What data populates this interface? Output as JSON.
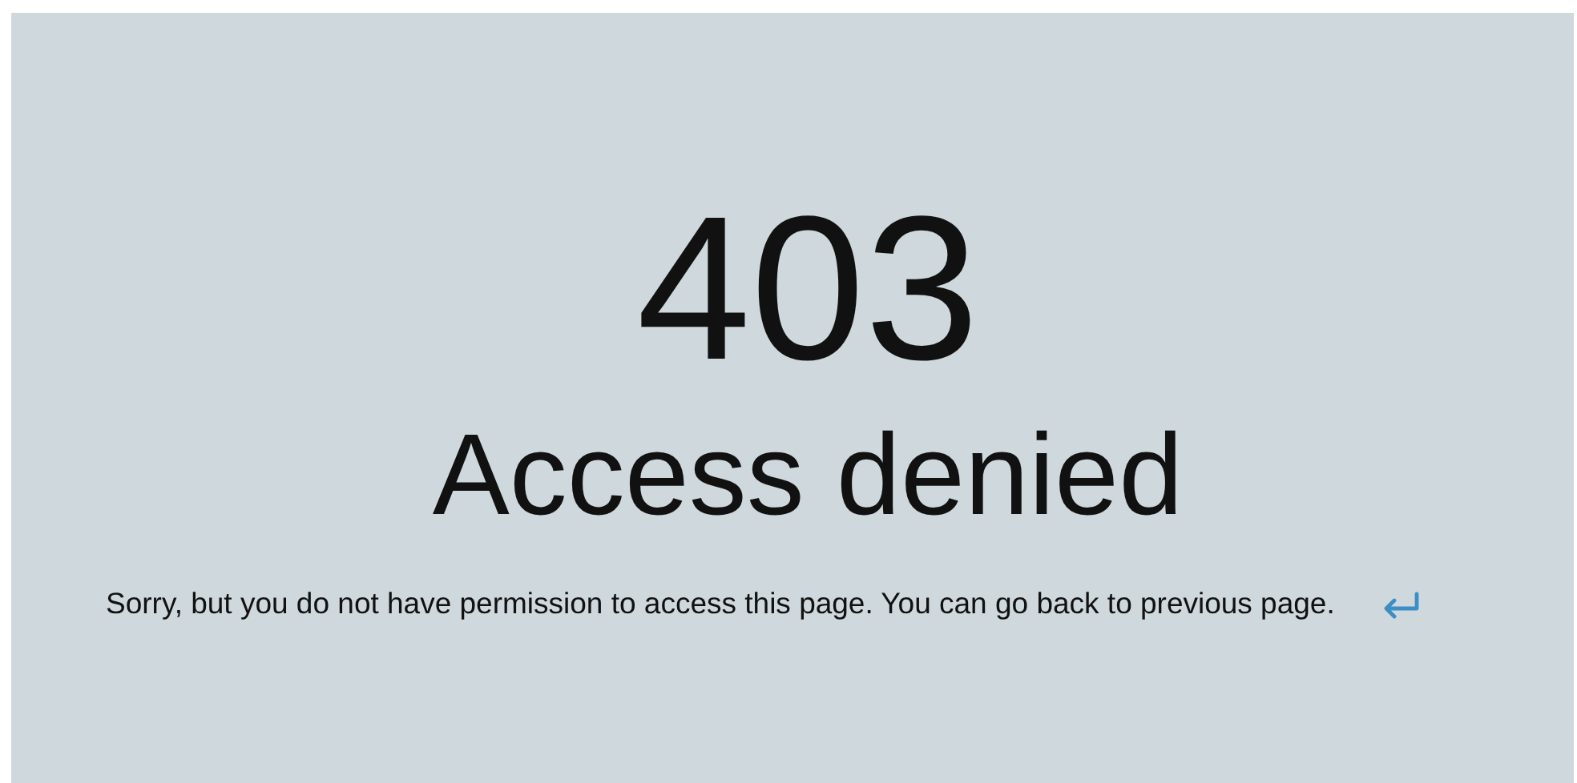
{
  "error": {
    "code": "403",
    "title": "Access denied",
    "message": "Sorry, but you do not have permission to access this page. You can go back to previous page."
  }
}
